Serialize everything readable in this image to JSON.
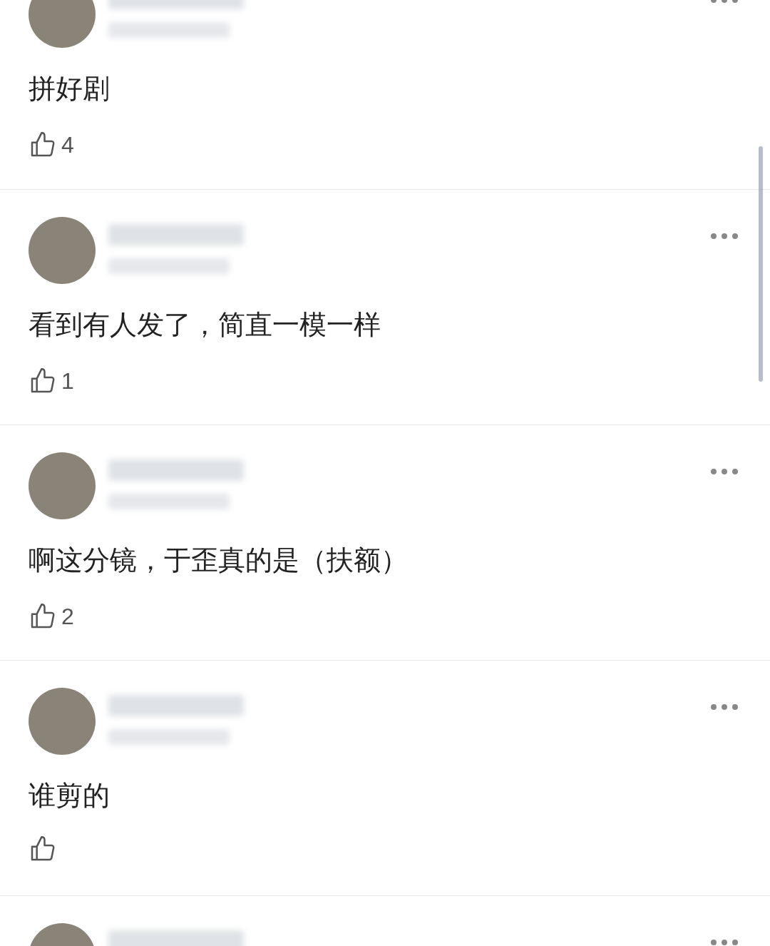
{
  "comments": [
    {
      "kind": "full",
      "text": "拼好剧",
      "likes": "4"
    },
    {
      "kind": "full",
      "text": "看到有人发了，简直一模一样",
      "likes": "1"
    },
    {
      "kind": "full",
      "text": "啊这分镜，于歪真的是（扶额）",
      "likes": "2"
    },
    {
      "kind": "full",
      "text": "谁剪的"
    },
    {
      "kind": "cut"
    }
  ]
}
